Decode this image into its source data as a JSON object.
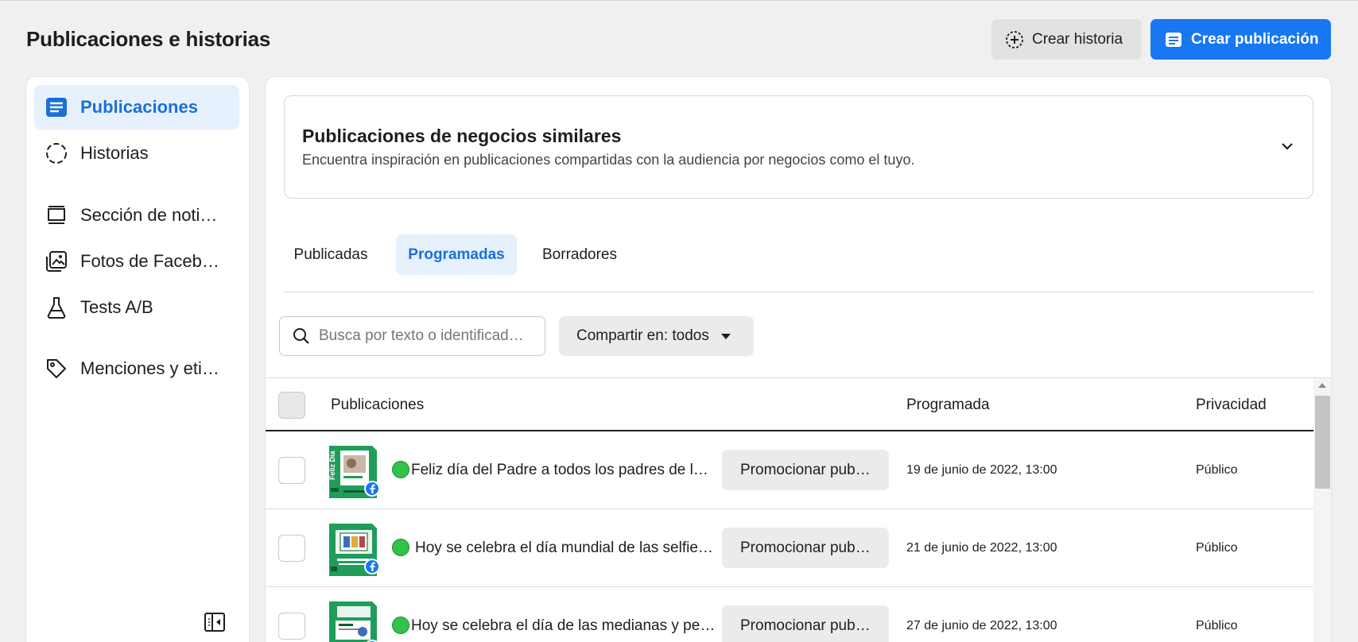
{
  "page": {
    "title": "Publicaciones e historias",
    "create_story_label": "Crear historia",
    "create_post_label": "Crear publicación",
    "accent_color": "#1877f2"
  },
  "sidebar": {
    "items": [
      {
        "label": "Publicaciones",
        "icon": "posts-icon",
        "active": true
      },
      {
        "label": "Historias",
        "icon": "stories-icon"
      },
      {
        "label": "Sección de noti…",
        "icon": "feed-icon"
      },
      {
        "label": "Fotos de Faceb…",
        "icon": "photos-icon"
      },
      {
        "label": "Tests A/B",
        "icon": "flask-icon"
      },
      {
        "label": "Menciones y eti…",
        "icon": "tag-icon"
      }
    ]
  },
  "similar": {
    "title": "Publicaciones de negocios similares",
    "description": "Encuentra inspiración en publicaciones compartidas con la audiencia por negocios como el tuyo."
  },
  "tabs": [
    {
      "label": "Publicadas"
    },
    {
      "label": "Programadas",
      "active": true
    },
    {
      "label": "Borradores"
    }
  ],
  "search": {
    "placeholder": "Busca por texto o identificad…"
  },
  "filter": {
    "label": "Compartir en: todos"
  },
  "table": {
    "headers": [
      "Publicaciones",
      "Programada",
      "Privacidad"
    ],
    "promote_label": "Promocionar pub…",
    "rows": [
      {
        "text": "Feliz día del Padre a todos los padres de l…",
        "date": "19 de junio de 2022, 13:00",
        "privacy": "Público",
        "status": "green"
      },
      {
        "text": "Hoy se celebra el día mundial de las selfie…",
        "date": "21 de junio de 2022, 13:00",
        "privacy": "Público",
        "status": "green"
      },
      {
        "text": "Hoy se celebra el día de las medianas y pe…",
        "date": "27 de junio de 2022, 13:00",
        "privacy": "Público",
        "status": "green"
      }
    ]
  }
}
